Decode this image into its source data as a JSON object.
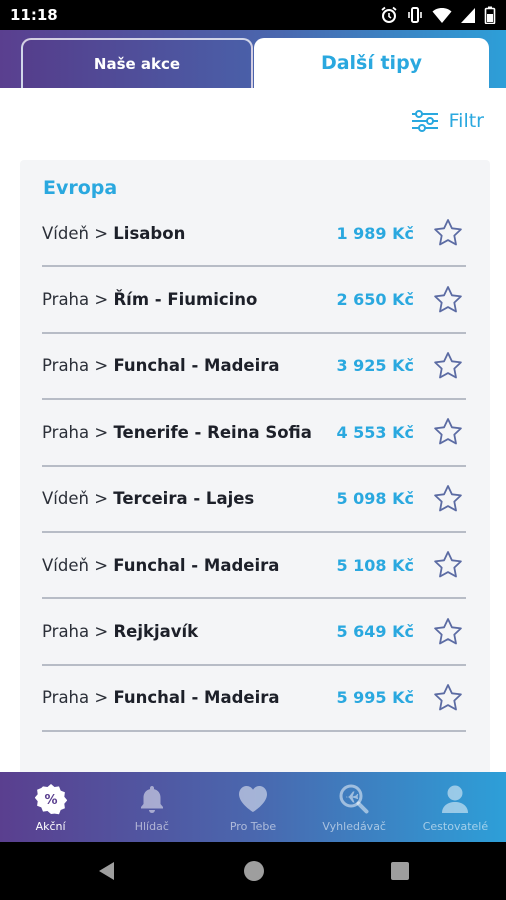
{
  "status_bar": {
    "time": "11:18"
  },
  "tabs": [
    {
      "label": "Naše akce",
      "active": false
    },
    {
      "label": "Další tipy",
      "active": true
    }
  ],
  "filter": {
    "label": "Filtr",
    "icon": "sliders-icon"
  },
  "section": {
    "title": "Evropa"
  },
  "deals": [
    {
      "origin": "Vídeň",
      "separator": " > ",
      "destination": "Lisabon",
      "price": "1 989 Kč"
    },
    {
      "origin": "Praha",
      "separator": " > ",
      "destination": "Řím - Fiumicino",
      "price": "2 650 Kč"
    },
    {
      "origin": "Praha",
      "separator": " > ",
      "destination": "Funchal - Madeira",
      "price": "3 925 Kč"
    },
    {
      "origin": "Praha",
      "separator": " > ",
      "destination": "Tenerife - Reina Sofia",
      "price": "4 553 Kč"
    },
    {
      "origin": "Vídeň",
      "separator": " > ",
      "destination": "Terceira - Lajes",
      "price": "5 098 Kč"
    },
    {
      "origin": "Vídeň",
      "separator": " > ",
      "destination": "Funchal - Madeira",
      "price": "5 108 Kč"
    },
    {
      "origin": "Praha",
      "separator": " > ",
      "destination": "Rejkjavík",
      "price": "5 649 Kč"
    },
    {
      "origin": "Praha",
      "separator": " > ",
      "destination": "Funchal - Madeira",
      "price": "5 995 Kč"
    }
  ],
  "bottom_nav": [
    {
      "label": "Akční",
      "icon": "percent-badge-icon",
      "active": true
    },
    {
      "label": "Hlídač",
      "icon": "bell-icon",
      "active": false
    },
    {
      "label": "Pro Tebe",
      "icon": "heart-icon",
      "active": false
    },
    {
      "label": "Vyhledávač",
      "icon": "search-plane-icon",
      "active": false
    },
    {
      "label": "Cestovatelé",
      "icon": "person-icon",
      "active": false
    }
  ],
  "colors": {
    "accent": "#2aa8df",
    "gradient_start": "#5a3f8f",
    "gradient_end": "#2d9fd8"
  }
}
